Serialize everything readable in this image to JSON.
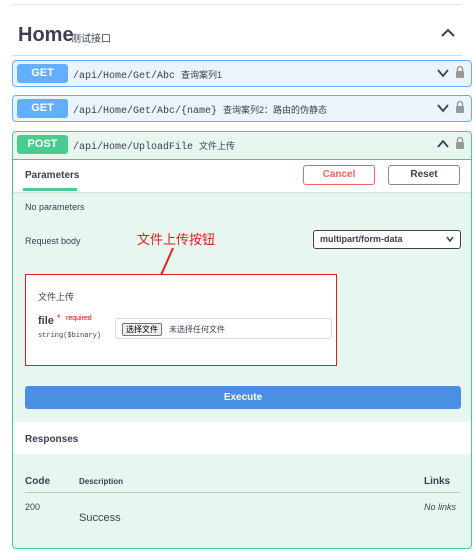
{
  "section": {
    "title": "Home",
    "description": "测试接口"
  },
  "operations": [
    {
      "method": "GET",
      "path": "/api/Home/Get/Abc",
      "summary": "查询案列1"
    },
    {
      "method": "GET",
      "path": "/api/Home/Get/Abc/{name}",
      "summary": "查询案列2：路由的伪静态"
    },
    {
      "method": "POST",
      "path": "/api/Home/UploadFile",
      "summary": "文件上传"
    }
  ],
  "post_panel": {
    "parameters_tab": "Parameters",
    "cancel_label": "Cancel",
    "reset_label": "Reset",
    "no_parameters": "No parameters",
    "request_body_label": "Request body",
    "content_type": "multipart/form-data",
    "annotation": "文件上传按钮",
    "upload": {
      "title": "文件上传",
      "field_name": "file",
      "required_star": "*",
      "required_text": "required",
      "field_type": "string($binary)",
      "choose_button": "选择文件",
      "no_file_text": "未选择任何文件"
    },
    "execute_label": "Execute",
    "responses_title": "Responses",
    "table": {
      "headers": {
        "code": "Code",
        "description": "Description",
        "links": "Links"
      },
      "rows": [
        {
          "code": "200",
          "description": "Success",
          "links": "No links"
        }
      ]
    }
  },
  "colors": {
    "get": "#61affe",
    "post": "#49cc90",
    "cancel": "#ff6060",
    "execute": "#4990e2",
    "annotation": "#e02020"
  },
  "icons": {
    "section_toggle": "chevron-up-icon",
    "op_toggle_collapsed": "chevron-down-icon",
    "op_toggle_expanded": "chevron-up-icon",
    "auth": "lock-icon",
    "select_caret": "chevron-down-icon"
  }
}
